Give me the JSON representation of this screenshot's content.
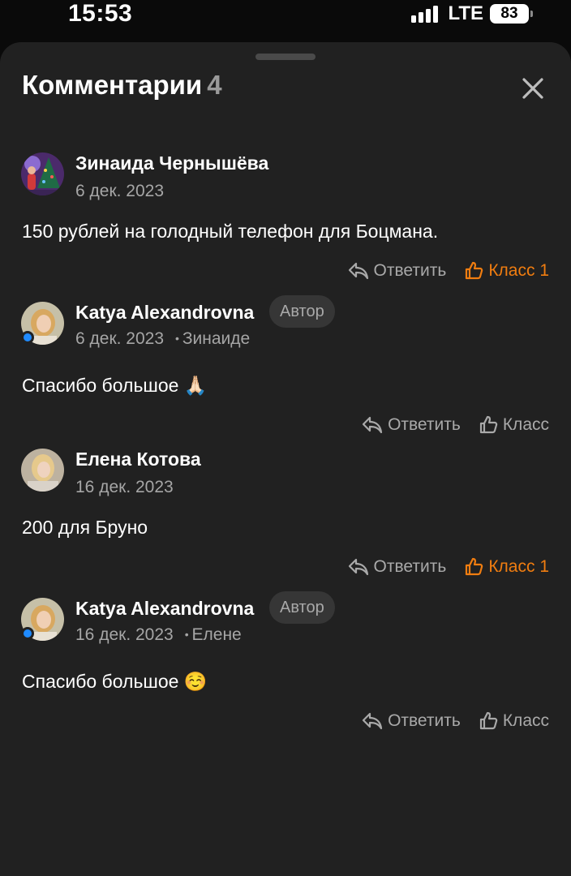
{
  "status_bar": {
    "time": "15:53",
    "network": "LTE",
    "battery": "83"
  },
  "sheet": {
    "title": "Комментарии",
    "count": "4",
    "close_icon": "close-icon"
  },
  "colors": {
    "background": "#212121",
    "accent_like": "#f07d10",
    "online": "#1f8bff"
  },
  "comments": [
    {
      "author": "Зинаида Чернышёва",
      "date": "6 дек. 2023",
      "text": "150 рублей на голодный телефон для Боцмана.",
      "reply_label": "Ответить",
      "like_label": "Класс 1",
      "liked": true
    },
    {
      "author": "Katya Alexandrovna",
      "badge": "Автор",
      "date": "6 дек. 2023",
      "reply_to": "Зинаиде",
      "text": "Спасибо большое 🙏🏻",
      "reply_label": "Ответить",
      "like_label": "Класс",
      "liked": false,
      "online": true
    },
    {
      "author": "Елена Котова",
      "date": "16 дек. 2023",
      "text": "200 для Бруно",
      "reply_label": "Ответить",
      "like_label": "Класс 1",
      "liked": true
    },
    {
      "author": "Katya Alexandrovna",
      "badge": "Автор",
      "date": "16 дек. 2023",
      "reply_to": "Елене",
      "text": "Спасибо большое ☺️",
      "reply_label": "Ответить",
      "like_label": "Класс",
      "liked": false,
      "online": true
    }
  ]
}
